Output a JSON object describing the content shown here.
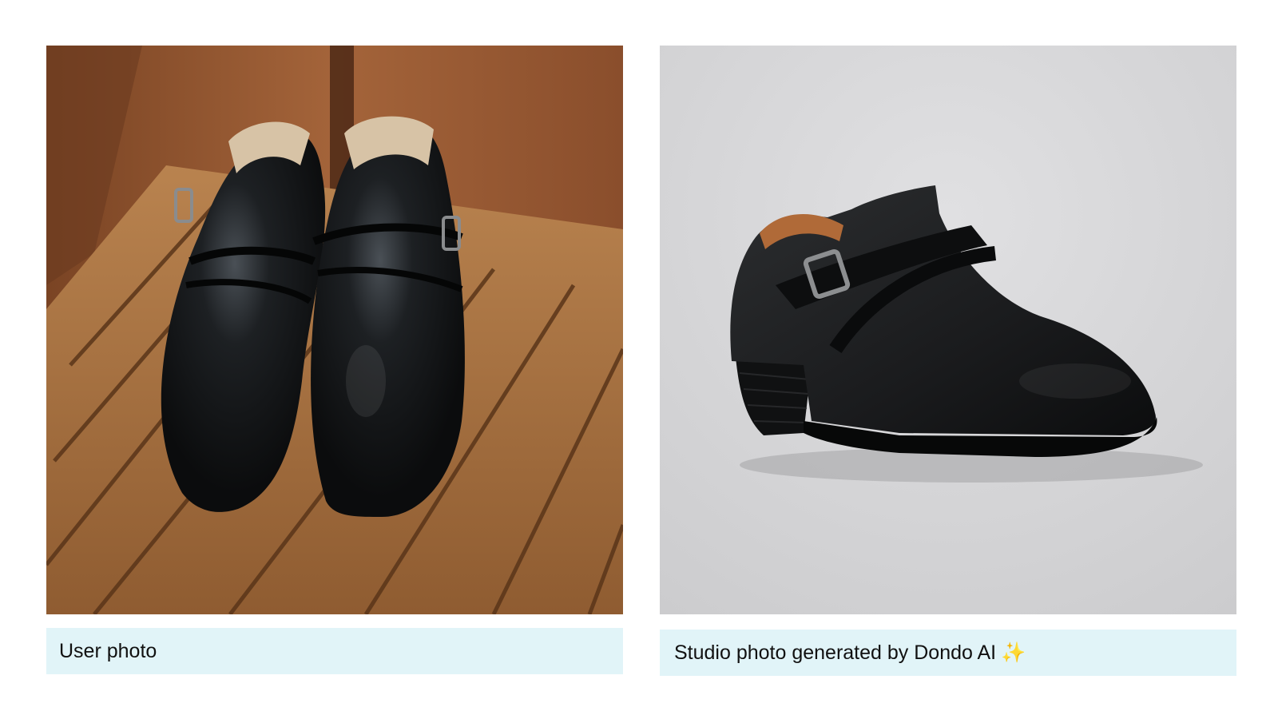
{
  "left_panel": {
    "caption": "User photo",
    "image_subject": "pair of black leather ankle boots with buckle straps on a wooden slatted bench"
  },
  "right_panel": {
    "caption": "Studio photo generated by Dondo AI",
    "caption_emoji": "✨",
    "image_subject": "single black leather ankle boot with crossed buckle strap on light grey studio background"
  },
  "colors": {
    "caption_bg": "#e1f4f8",
    "studio_bg": "#d9d9db",
    "wood": "#a8703e",
    "leather": "#16181a"
  }
}
